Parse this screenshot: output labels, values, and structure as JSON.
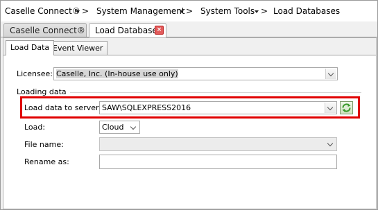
{
  "breadcrumb": {
    "items": [
      "Caselle Connect®",
      "System Management",
      "System Tools",
      "Load Databases"
    ],
    "separator": ">"
  },
  "doc_tabs": [
    {
      "label": "Caselle Connect®",
      "active": false
    },
    {
      "label": "Load Databases",
      "active": true
    }
  ],
  "sub_tabs": [
    {
      "label": "Load Data",
      "active": true
    },
    {
      "label": "Event Viewer",
      "active": false
    }
  ],
  "form": {
    "licensee_label": "Licensee:",
    "licensee_value": "Caselle, Inc. (In-house use only)",
    "group_label": "Loading data",
    "server_label": "Load data to server:",
    "server_value": "SAW\\SQLEXPRESS2016",
    "load_label": "Load:",
    "load_value": "Cloud",
    "file_name_label": "File name:",
    "file_name_value": "",
    "rename_label": "Rename as:",
    "rename_value": ""
  },
  "colors": {
    "highlight_border": "#e00000",
    "refresh_icon": "#3a9a2a"
  },
  "icons": [
    "dropdown-arrow-icon",
    "close-icon",
    "chevron-down-icon",
    "refresh-icon"
  ]
}
